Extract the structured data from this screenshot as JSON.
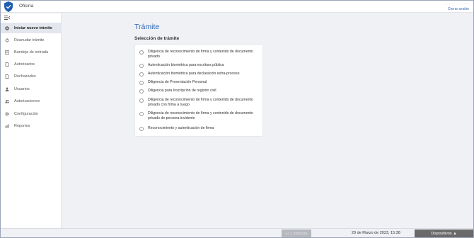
{
  "header": {
    "office": "Oficina",
    "user_name": "····················",
    "logout": "Cerrar sesión",
    "brand_color": "#1f5cb3"
  },
  "sidebar": {
    "collapse_icon": "menu-collapse-icon",
    "items": [
      {
        "label": "Iniciar nuevo trámite",
        "icon": "plus-circle-icon",
        "active": true
      },
      {
        "label": "Reanudar trámite",
        "icon": "refresh-icon",
        "active": false
      },
      {
        "label": "Bandeja de entrada",
        "icon": "inbox-icon",
        "active": false
      },
      {
        "label": "Autorizados",
        "icon": "document-icon",
        "active": false
      },
      {
        "label": "Rechazados",
        "icon": "document-icon",
        "active": false
      },
      {
        "label": "Usuarios",
        "icon": "user-icon",
        "active": false
      },
      {
        "label": "Autorizaciones",
        "icon": "users-icon",
        "active": false
      },
      {
        "label": "Configuración",
        "icon": "gear-icon",
        "active": false
      },
      {
        "label": "Reportes",
        "icon": "chart-icon",
        "active": false
      }
    ]
  },
  "main": {
    "title": "Trámite",
    "section": "Selección de trámite",
    "options": [
      "Diligencia de reconocimiento de firma y contenido de documento privado",
      "Autenticación biométrica para escritura pública",
      "Autenticación biométrica para declaración extra-proceso",
      "Diligencia de Presentación Personal",
      "Diligencia para Inscripción de registro civil",
      "Diligencia de reconocimiento de firma y contenido de documento privado con firma a ruego",
      "Diligencia de reconocimiento de firma y contenido de documento privado de persona invidente",
      "Reconocimiento y autenticación de firma"
    ]
  },
  "footer": {
    "version": "v-1.1.23032316",
    "datetime": "29 de Marzo de 2023, 15:38",
    "devices": "Dispositivos ▲"
  }
}
